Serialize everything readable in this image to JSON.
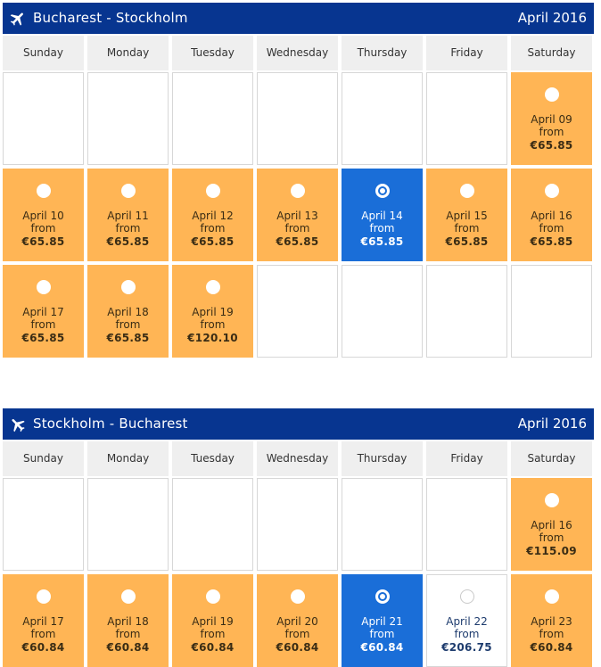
{
  "day_headers": [
    "Sunday",
    "Monday",
    "Tuesday",
    "Wednesday",
    "Thursday",
    "Friday",
    "Saturday"
  ],
  "from_label": "from",
  "calendars": [
    {
      "route": "Bucharest - Stockholm",
      "month": "April 2016",
      "weeks": [
        [
          null,
          null,
          null,
          null,
          null,
          null,
          {
            "date": "April 09",
            "price": "€65.85",
            "state": "available"
          }
        ],
        [
          {
            "date": "April 10",
            "price": "€65.85",
            "state": "available"
          },
          {
            "date": "April 11",
            "price": "€65.85",
            "state": "available"
          },
          {
            "date": "April 12",
            "price": "€65.85",
            "state": "available"
          },
          {
            "date": "April 13",
            "price": "€65.85",
            "state": "available"
          },
          {
            "date": "April 14",
            "price": "€65.85",
            "state": "selected"
          },
          {
            "date": "April 15",
            "price": "€65.85",
            "state": "available"
          },
          {
            "date": "April 16",
            "price": "€65.85",
            "state": "available"
          }
        ],
        [
          {
            "date": "April 17",
            "price": "€65.85",
            "state": "available"
          },
          {
            "date": "April 18",
            "price": "€65.85",
            "state": "available"
          },
          {
            "date": "April 19",
            "price": "€120.10",
            "state": "available"
          },
          null,
          null,
          null,
          null
        ]
      ]
    },
    {
      "route": "Stockholm - Bucharest",
      "month": "April 2016",
      "weeks": [
        [
          null,
          null,
          null,
          null,
          null,
          null,
          {
            "date": "April 16",
            "price": "€115.09",
            "state": "available"
          }
        ],
        [
          {
            "date": "April 17",
            "price": "€60.84",
            "state": "available"
          },
          {
            "date": "April 18",
            "price": "€60.84",
            "state": "available"
          },
          {
            "date": "April 19",
            "price": "€60.84",
            "state": "available"
          },
          {
            "date": "April 20",
            "price": "€60.84",
            "state": "available"
          },
          {
            "date": "April 21",
            "price": "€60.84",
            "state": "selected"
          },
          {
            "date": "April 22",
            "price": "€206.75",
            "state": "unhighlighted"
          },
          {
            "date": "April 23",
            "price": "€60.84",
            "state": "available"
          }
        ]
      ]
    }
  ],
  "colors": {
    "header_bar": "#073590",
    "available": "#ffb555",
    "selected": "#1a6ed8",
    "day_header_bg": "#efefef"
  },
  "icons": {
    "route": "airplane-icon",
    "day_option": "radio-button"
  }
}
